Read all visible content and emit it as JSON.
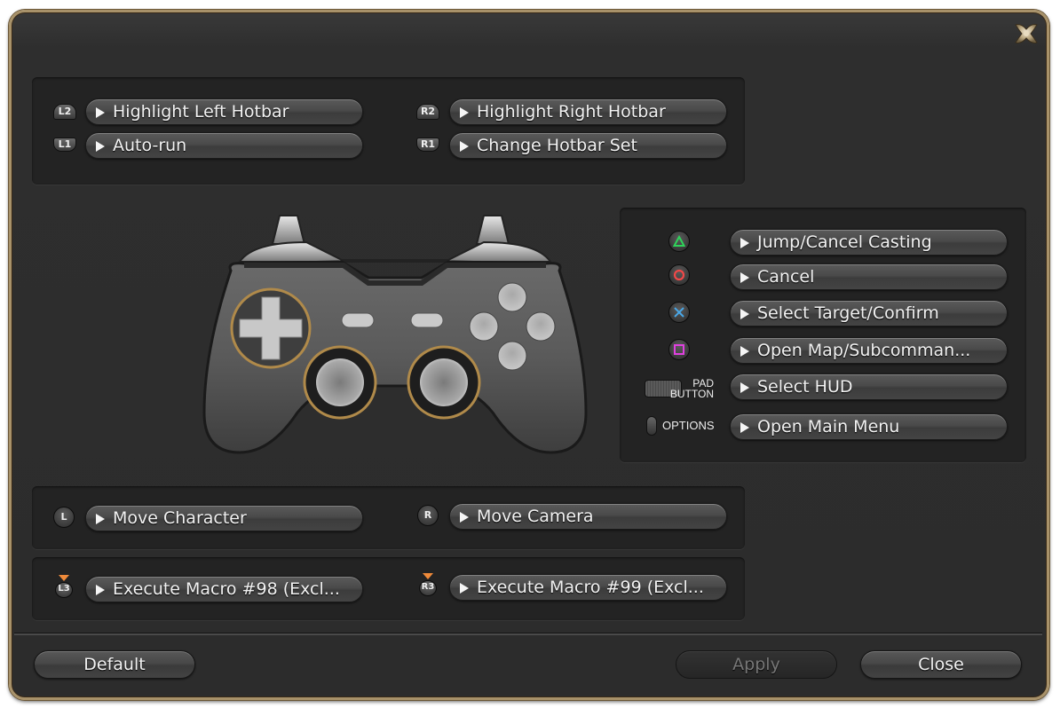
{
  "window": {
    "close_icon": "ornate-close-x-icon",
    "frame_color": "#a8926a"
  },
  "shoulder_panel": {
    "left": [
      {
        "button": "L2",
        "icon": "l2-trigger-icon",
        "action": "Highlight Left Hotbar"
      },
      {
        "button": "L1",
        "icon": "l1-bumper-icon",
        "action": "Auto-run"
      }
    ],
    "right": [
      {
        "button": "R2",
        "icon": "r2-trigger-icon",
        "action": "Highlight Right Hotbar"
      },
      {
        "button": "R1",
        "icon": "r1-bumper-icon",
        "action": "Change Hotbar Set"
      }
    ]
  },
  "controller_image": {
    "icon": "gamepad-icon"
  },
  "face_panel": {
    "items": [
      {
        "button": "Triangle",
        "icon": "triangle-button-icon",
        "color": "#2fd35a",
        "action": "Jump/Cancel Casting"
      },
      {
        "button": "Circle",
        "icon": "circle-button-icon",
        "color": "#f04848",
        "action": "Cancel"
      },
      {
        "button": "Cross",
        "icon": "cross-button-icon",
        "color": "#4aa8e8",
        "action": "Select Target/Confirm"
      },
      {
        "button": "Square",
        "icon": "square-button-icon",
        "color": "#e040e0",
        "action": "Open Map/Subcomman..."
      },
      {
        "button": "PAD BUTTON",
        "label_line1": "PAD",
        "label_line2": "BUTTON",
        "icon": "touchpad-icon",
        "action": "Select HUD"
      },
      {
        "button": "OPTIONS",
        "label": "OPTIONS",
        "icon": "options-button-icon",
        "action": "Open Main Menu"
      }
    ]
  },
  "stick_panel": {
    "left": {
      "button": "L",
      "icon": "left-stick-icon",
      "action": "Move Character"
    },
    "right": {
      "button": "R",
      "icon": "right-stick-icon",
      "action": "Move Camera"
    }
  },
  "stick_press_panel": {
    "left": {
      "button": "L3",
      "icon": "l3-press-icon",
      "action": "Execute Macro #98 (Excl..."
    },
    "right": {
      "button": "R3",
      "icon": "r3-press-icon",
      "action": "Execute Macro #99 (Excl..."
    }
  },
  "footer": {
    "default_label": "Default",
    "apply_label": "Apply",
    "apply_enabled": false,
    "close_label": "Close"
  }
}
